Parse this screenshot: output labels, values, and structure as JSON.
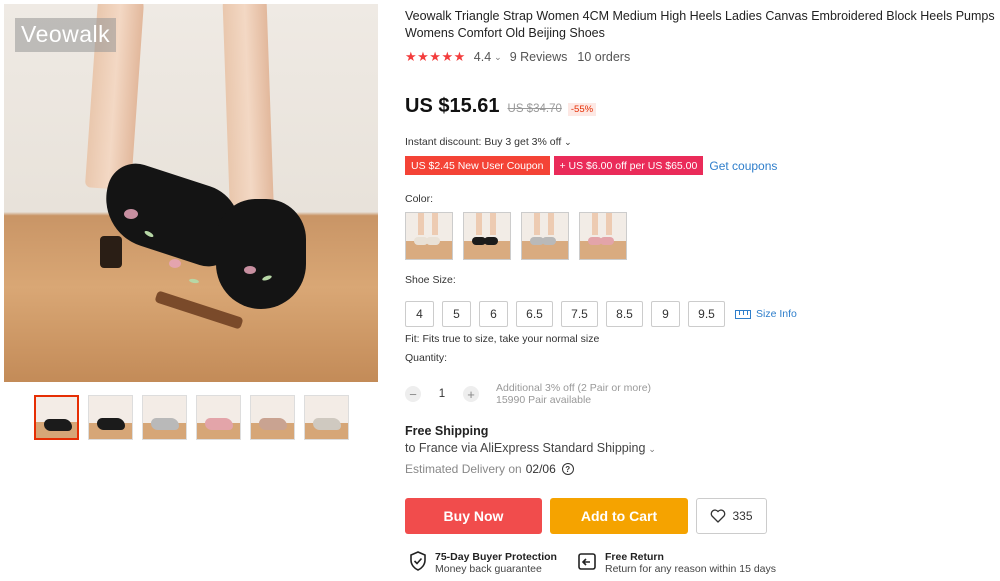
{
  "gallery": {
    "watermark": "Veowalk",
    "thumbnails": [
      {
        "name": "thumb-1",
        "shoe_color": "#1b1b1b"
      },
      {
        "name": "thumb-2",
        "shoe_color": "#1b1b1b"
      },
      {
        "name": "thumb-3",
        "shoe_color": "#b9b9b9"
      },
      {
        "name": "thumb-4",
        "shoe_color": "#e3a4a9"
      },
      {
        "name": "thumb-5",
        "shoe_color": "#c9a391"
      },
      {
        "name": "thumb-6",
        "shoe_color": "#cfc9c0"
      }
    ]
  },
  "product": {
    "title": "Veowalk Triangle Strap Women 4CM Medium High Heels Ladies Canvas Embroidered Block Heels Pumps Womens Comfort Old Beijing Shoes",
    "rating": "4.4",
    "reviews": "9 Reviews",
    "orders": "10 orders",
    "price": "US $15.61",
    "old_price": "US $34.70",
    "discount": "-55%",
    "instant_discount": "Instant discount: Buy 3 get 3% off",
    "coupons": [
      "US $2.45 New User Coupon",
      "+ US $6.00 off per US $65.00"
    ],
    "get_coupons": "Get coupons",
    "color_label": "Color:",
    "colors": [
      "#e9e1d6",
      "#1b1b1b",
      "#b9b9b9",
      "#e3a4a9"
    ],
    "size_label": "Shoe Size:",
    "sizes": [
      "4",
      "5",
      "6",
      "6.5",
      "7.5",
      "8.5",
      "9",
      "9.5"
    ],
    "size_info": "Size Info",
    "fit": "Fit: Fits true to size, take your normal size",
    "quantity_label": "Quantity:",
    "quantity": "1",
    "qty_note_1": "Additional 3% off (2 Pair or more)",
    "qty_note_2": "15990 Pair available"
  },
  "shipping": {
    "title": "Free Shipping",
    "to": "to France via AliExpress Standard Shipping",
    "estimated_label": "Estimated Delivery on",
    "date": "02/06"
  },
  "actions": {
    "buy_now": "Buy Now",
    "add_to_cart": "Add to Cart",
    "wishlist_count": "335"
  },
  "guarantees": [
    {
      "title": "75-Day Buyer Protection",
      "sub": "Money back guarantee",
      "icon": "shield-check-icon"
    },
    {
      "title": "Free Return",
      "sub": "Return for any reason within 15 days",
      "icon": "return-icon"
    }
  ],
  "colors": {
    "accent_red": "#f14c4c",
    "cart_orange": "#f5a300",
    "link_blue": "#2e7ecb",
    "star_red": "#f33c3c"
  }
}
